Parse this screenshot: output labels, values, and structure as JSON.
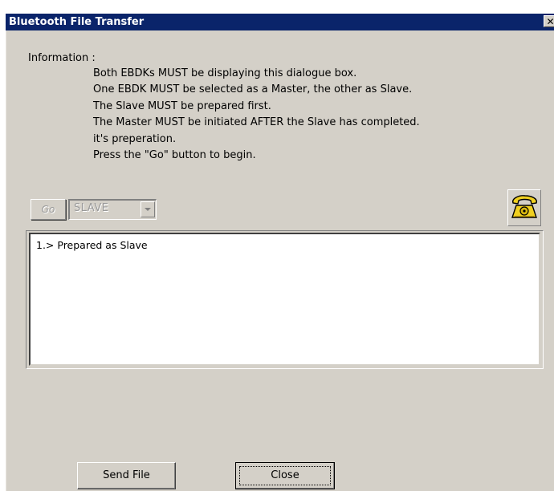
{
  "window": {
    "title": "Bluetooth File Transfer",
    "close_glyph": "✕"
  },
  "info": {
    "heading": "Information :",
    "lines": [
      "Both EBDKs MUST be displaying this dialogue box.",
      "One EBDK MUST be selected as a Master, the other as Slave.",
      "The Slave MUST be prepared first.",
      "The Master MUST be initiated AFTER the Slave has completed.",
      "it's preperation.",
      "Press the \"Go\" button to begin."
    ]
  },
  "controls": {
    "go_label": "Go",
    "go_enabled": false,
    "mode_value": "SLAVE",
    "mode_enabled": false,
    "phone_icon": "telephone-icon"
  },
  "log": {
    "lines": [
      "1.> Prepared as Slave"
    ]
  },
  "buttons": {
    "send_file": "Send File",
    "close": "Close"
  },
  "colors": {
    "titlebar": "#0a246a",
    "face": "#d4d0c8",
    "phone_body": "#f0d020"
  }
}
